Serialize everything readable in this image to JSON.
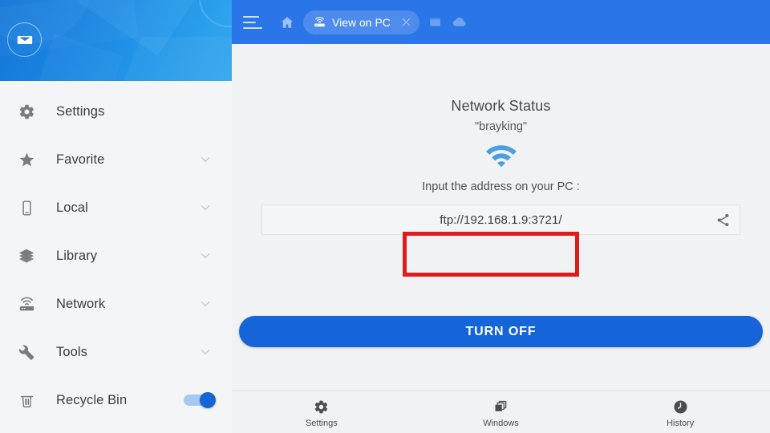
{
  "sidebar": {
    "avatar_icon": "envelope-icon",
    "items": [
      {
        "label": "Settings",
        "icon": "gear-icon",
        "trailing": "none"
      },
      {
        "label": "Favorite",
        "icon": "star-icon",
        "trailing": "chevron-down-icon"
      },
      {
        "label": "Local",
        "icon": "phone-icon",
        "trailing": "chevron-down-icon"
      },
      {
        "label": "Library",
        "icon": "layers-icon",
        "trailing": "chevron-down-icon"
      },
      {
        "label": "Network",
        "icon": "router-icon",
        "trailing": "chevron-down-icon"
      },
      {
        "label": "Tools",
        "icon": "wrench-icon",
        "trailing": "chevron-down-icon"
      },
      {
        "label": "Recycle Bin",
        "icon": "trash-icon",
        "trailing": "toggle-on"
      }
    ]
  },
  "topbar": {
    "menu_icon": "hamburger-menu-icon",
    "home_icon": "home-icon",
    "tab": {
      "label": "View on PC",
      "icon": "router-icon",
      "close_icon": "close-icon"
    },
    "extra_icons": [
      {
        "name": "window-icon"
      },
      {
        "name": "cloud-icon"
      }
    ],
    "background_color": "#2a75e8"
  },
  "content": {
    "title": "Network Status",
    "ssid": "\"brayking\"",
    "wifi_icon": "wifi-icon",
    "wifi_color": "#4a9fe0",
    "prompt": "Input the address on your PC :",
    "address": "ftp://192.168.1.9:3721/",
    "share_icon": "share-icon",
    "highlight_color": "#e01b1b",
    "turn_off_label": "TURN OFF",
    "turn_off_color": "#1565d8"
  },
  "bottomnav": {
    "items": [
      {
        "label": "Settings",
        "icon": "gear-icon"
      },
      {
        "label": "Windows",
        "icon": "windows-stack-icon"
      },
      {
        "label": "History",
        "icon": "clock-icon"
      }
    ]
  }
}
